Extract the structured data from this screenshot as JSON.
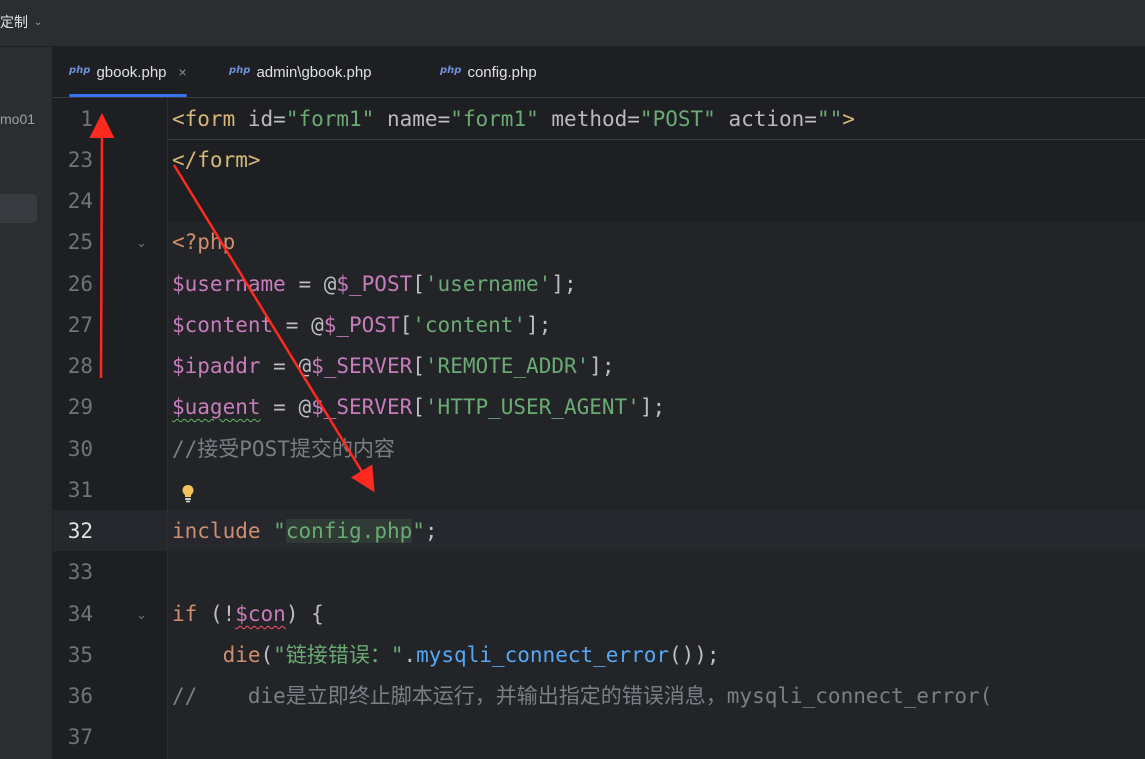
{
  "topbar": {
    "menu_label": "定制"
  },
  "left_panel": {
    "project_label": "mo01"
  },
  "tabs": [
    {
      "label": "gbook.php",
      "icon": "php-file-icon",
      "active": true
    },
    {
      "label": "admin\\gbook.php",
      "icon": "php-file-icon",
      "active": false
    },
    {
      "label": "config.php",
      "icon": "php-file-icon",
      "active": false
    }
  ],
  "gutter": {
    "line_numbers": [
      "1",
      "23",
      "24",
      "25",
      "26",
      "27",
      "28",
      "29",
      "30",
      "31",
      "32",
      "33",
      "34",
      "35",
      "36",
      "37"
    ],
    "current_line": "32"
  },
  "code": {
    "l1": {
      "open": "<form",
      "a1": "id",
      "v1": "\"form1\"",
      "a2": "name",
      "v2": "\"form1\"",
      "a3": "method",
      "v3": "\"POST\"",
      "a4": "action",
      "v4": "\"\"",
      "close": ">"
    },
    "l23": "</form>",
    "l25": "<?php",
    "l26": {
      "var": "$username",
      "op": " = @",
      "sg": "$_POST",
      "key": "'username'",
      "end": "];"
    },
    "l27": {
      "var": "$content",
      "op": " = @",
      "sg": "$_POST",
      "key": "'content'",
      "end": "];"
    },
    "l28": {
      "var": "$ipaddr",
      "op": " = @",
      "sg": "$_SERVER",
      "key": "'REMOTE_ADDR'",
      "end": "];"
    },
    "l29": {
      "var": "$uagent",
      "op": " = @",
      "sg": "$_SERVER",
      "key": "'HTTP_USER_AGENT'",
      "end": "];"
    },
    "l30": "//接受POST提交的内容",
    "l32": {
      "kw": "include",
      "q1": " \"",
      "file": "config.php",
      "q2": "\"",
      "end": ";"
    },
    "l34": {
      "kw": "if",
      "open": " (!",
      "var": "$con",
      "close": ") {"
    },
    "l35": {
      "fn": "die",
      "open": "(",
      "str": "\"链接错误：\"",
      "dot": ".",
      "call": "mysqli_connect_error",
      "end": "());"
    },
    "l36": "//    die是立即终止脚本运行，并输出指定的错误消息，mysqli_connect_error("
  },
  "colors": {
    "accent": "#3574f0",
    "annotation_arrow": "#ff2a1f"
  }
}
